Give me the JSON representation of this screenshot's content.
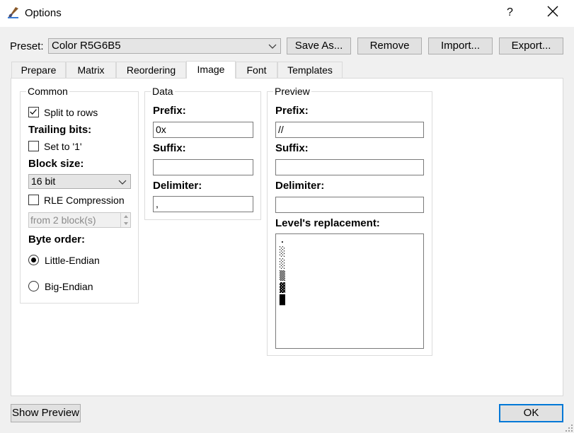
{
  "window": {
    "title": "Options",
    "help_label": "?"
  },
  "preset": {
    "label": "Preset:",
    "selected": "Color R5G6B5"
  },
  "buttons": {
    "save_as": "Save As...",
    "remove": "Remove",
    "import": "Import...",
    "export": "Export...",
    "show_preview": "Show Preview",
    "ok": "OK"
  },
  "tabs": [
    {
      "label": "Prepare",
      "active": false
    },
    {
      "label": "Matrix",
      "active": false
    },
    {
      "label": "Reordering",
      "active": false
    },
    {
      "label": "Image",
      "active": true
    },
    {
      "label": "Font",
      "active": false
    },
    {
      "label": "Templates",
      "active": false
    }
  ],
  "common": {
    "title": "Common",
    "split_to_rows": {
      "label": "Split to rows",
      "checked": true
    },
    "trailing_bits_label": "Trailing bits:",
    "set_to_one": {
      "label": "Set to '1'",
      "checked": false
    },
    "block_size_label": "Block size:",
    "block_size_value": "16 bit",
    "rle": {
      "label": "RLE Compression",
      "checked": false
    },
    "rle_from_value": "from 2 block(s)",
    "byte_order_label": "Byte order:",
    "little_endian": {
      "label": "Little-Endian",
      "selected": true
    },
    "big_endian": {
      "label": "Big-Endian",
      "selected": false
    }
  },
  "data_group": {
    "title": "Data",
    "prefix_label": "Prefix:",
    "prefix_value": "0x",
    "suffix_label": "Suffix:",
    "suffix_value": "",
    "delimiter_label": "Delimiter:",
    "delimiter_value": ","
  },
  "preview_group": {
    "title": "Preview",
    "prefix_label": "Prefix:",
    "prefix_value": "//",
    "suffix_label": "Suffix:",
    "suffix_value": "",
    "delimiter_label": "Delimiter:",
    "delimiter_value": "",
    "levels_label": "Level's replacement:",
    "levels": [
      ".",
      "░",
      "░",
      "▒",
      "▓",
      "█"
    ]
  },
  "colors": {
    "window_bg": "#f0f0f0",
    "panel_bg": "#ffffff",
    "button_bg": "#e1e1e1",
    "default_button_border": "#0078d7"
  }
}
